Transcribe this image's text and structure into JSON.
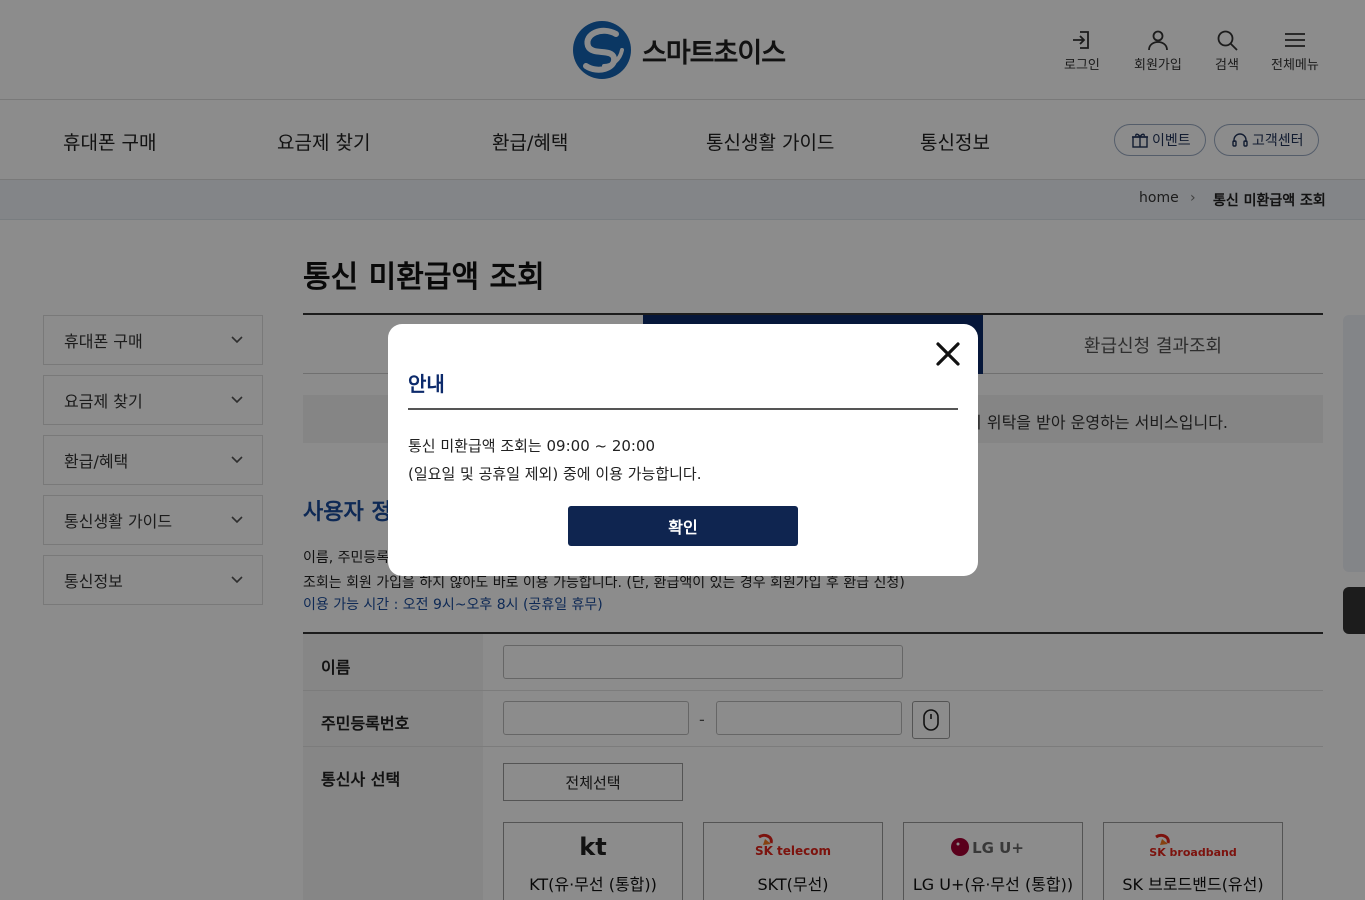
{
  "header": {
    "logo_text": "스마트초이스",
    "utils": [
      {
        "label": "로그인",
        "icon": "login-icon"
      },
      {
        "label": "회원가입",
        "icon": "user-icon"
      },
      {
        "label": "검색",
        "icon": "search-icon"
      },
      {
        "label": "전체메뉴",
        "icon": "hamburger-icon"
      }
    ]
  },
  "gnb": {
    "items": [
      "휴대폰 구매",
      "요금제 찾기",
      "환급/혜택",
      "통신생활 가이드",
      "통신정보"
    ],
    "event_label": "이벤트",
    "support_label": "고객센터"
  },
  "breadcrumb": {
    "home": "home",
    "separator": "›",
    "current": "통신 미환급액 조회"
  },
  "sidebar": {
    "items": [
      "휴대폰 구매",
      "요금제 찾기",
      "환급/혜택",
      "통신생활 가이드",
      "통신정보"
    ]
  },
  "content": {
    "page_title": "통신 미환급액 조회",
    "tabs": [
      "",
      "",
      "환급신청 결과조회"
    ],
    "active_tab_index": 1,
    "notice_visible": "의 위탁을 받아 운영하는 서비스입니다.",
    "section_title_visible": "사용자 정",
    "desc1_visible": "이름, 주민등록",
    "desc2": "조회는 회원 가입을 하지 않아도 바로 이용 가능합니다. (단, 환급액이 있는 경우 회원가입 후 환급 신청)",
    "desc3": "이용 가능 시간 : 오전 9시~오후 8시 (공휴일 휴무)"
  },
  "form": {
    "name_label": "이름",
    "rrn_label": "주민등록번호",
    "rrn_dash": "-",
    "carrier_label": "통신사 선택",
    "select_all": "전체선택",
    "carriers": [
      {
        "name": "KT(유·무선 (통합))",
        "logo": "kt"
      },
      {
        "name": "SKT(무선)",
        "logo": "SK telecom"
      },
      {
        "name": "LG U+(유·무선 (통합))",
        "logo": "LG U+"
      },
      {
        "name": "SK 브로드밴드(유선)",
        "logo": "SK broadband"
      }
    ]
  },
  "modal": {
    "title": "안내",
    "message_line1": "통신 미환급액 조회는 09:00 ~ 20:00",
    "message_line2": "(일요일 및 공휴일 제외) 중에 이용 가능합니다.",
    "confirm": "확인"
  },
  "colors": {
    "navy": "#0c2a6b",
    "button_navy": "#0f2550",
    "link_blue": "#1a4c9c"
  }
}
